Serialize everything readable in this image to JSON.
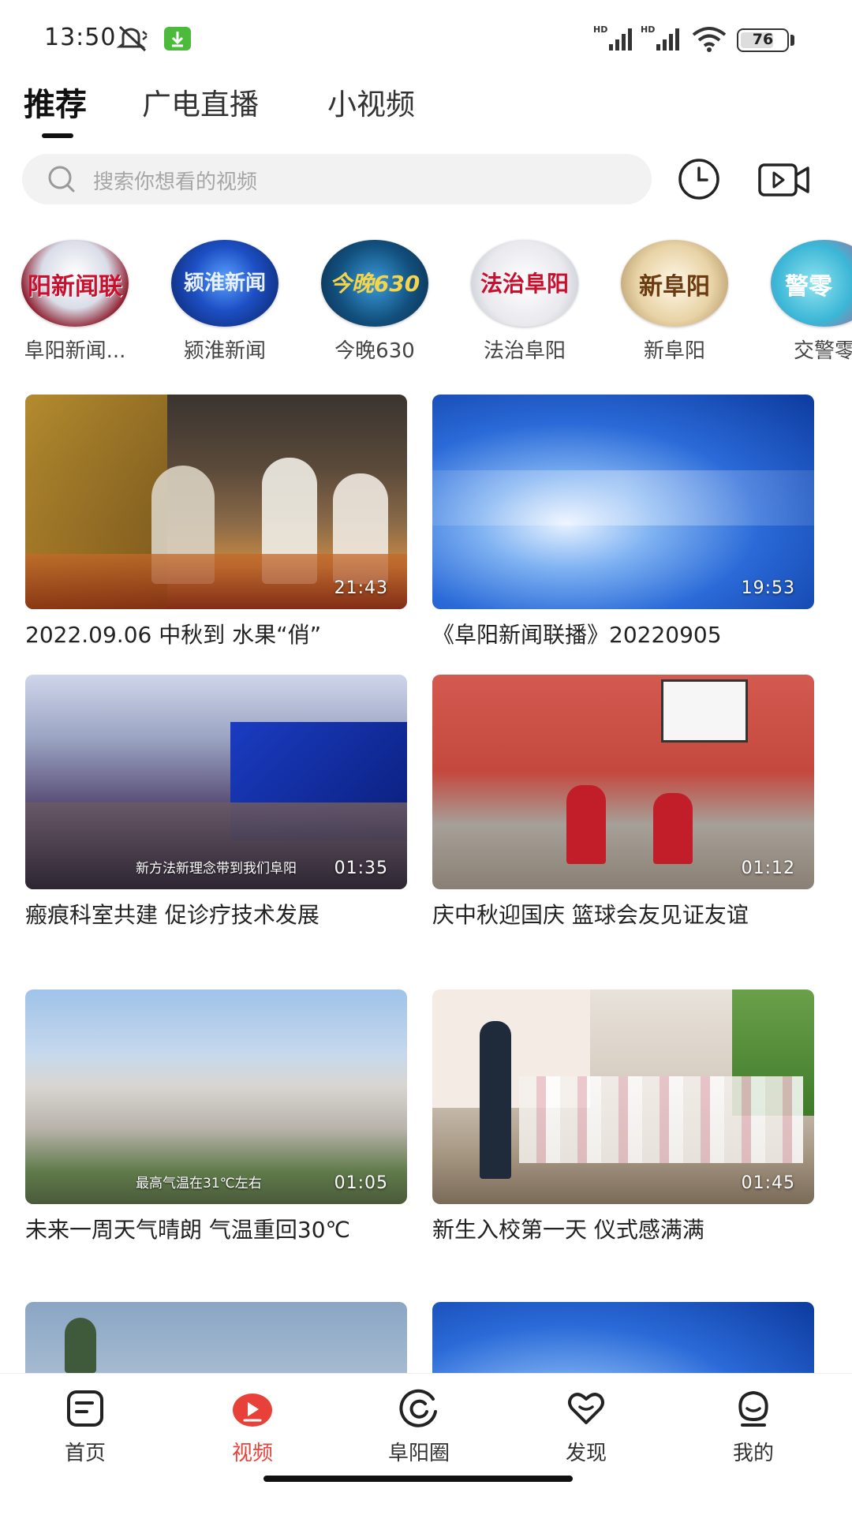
{
  "status_bar": {
    "time": "13:50",
    "battery": "76",
    "battery_level": 0.76
  },
  "tabs": [
    {
      "label": "推荐",
      "active": true
    },
    {
      "label": "广电直播",
      "active": false
    },
    {
      "label": "小视频",
      "active": false
    }
  ],
  "search": {
    "placeholder": "搜索你想看的视频"
  },
  "channels": [
    {
      "label": "阜阳新闻...",
      "logo_text": "阳新闻联"
    },
    {
      "label": "颍淮新闻",
      "logo_text": "颍淮新闻"
    },
    {
      "label": "今晚630",
      "logo_text": "今晚630"
    },
    {
      "label": "法治阜阳",
      "logo_text": "法治阜阳"
    },
    {
      "label": "新阜阳",
      "logo_text": "新阜阳"
    },
    {
      "label": "交警零",
      "logo_text": "警零"
    }
  ],
  "videos": [
    {
      "title": "2022.09.06 中秋到 水果“俏”",
      "duration": "21:43",
      "caption": ""
    },
    {
      "title": "《阜阳新闻联播》20220905",
      "duration": "19:53",
      "caption": ""
    },
    {
      "title": "瘢痕科室共建 促诊疗技术发展",
      "duration": "01:35",
      "caption": "新方法新理念带到我们阜阳"
    },
    {
      "title": "庆中秋迎国庆  篮球会友见证友谊",
      "duration": "01:12",
      "caption": ""
    },
    {
      "title": "未来一周天气晴朗  气温重回30℃",
      "duration": "01:05",
      "caption": "最高气温在31℃左右"
    },
    {
      "title": "新生入校第一天    仪式感满满",
      "duration": "01:45",
      "caption": ""
    },
    {
      "title": "",
      "duration": "",
      "caption": ""
    },
    {
      "title": "",
      "duration": "",
      "caption": ""
    }
  ],
  "bottom_nav": [
    {
      "label": "首页",
      "icon": "home-icon",
      "active": false
    },
    {
      "label": "视频",
      "icon": "video-icon",
      "active": true
    },
    {
      "label": "阜阳圈",
      "icon": "circle-icon",
      "active": false
    },
    {
      "label": "发现",
      "icon": "discover-icon",
      "active": false
    },
    {
      "label": "我的",
      "icon": "profile-icon",
      "active": false
    }
  ],
  "colors": {
    "accent": "#e8413a",
    "text": "#222222",
    "search_bg": "#f2f2f2"
  }
}
